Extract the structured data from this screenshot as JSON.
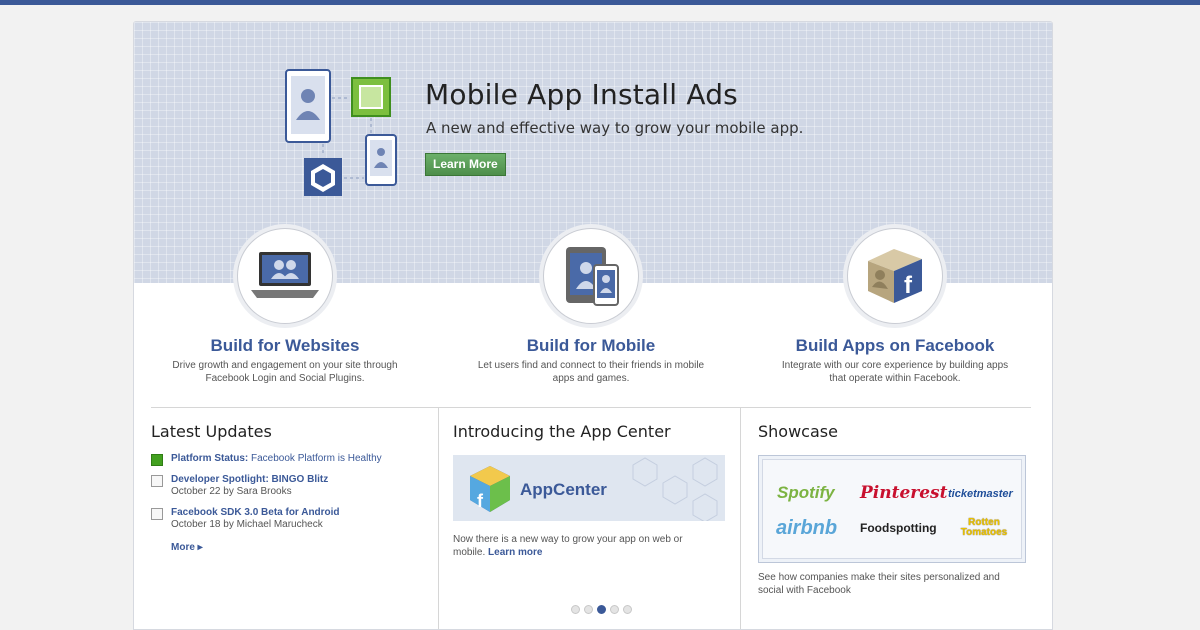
{
  "hero": {
    "title": "Mobile App Install Ads",
    "subtitle": "A new and effective way to grow your mobile app.",
    "cta_label": "Learn More"
  },
  "features": [
    {
      "title": "Build for Websites",
      "desc": "Drive growth and engagement on your site through Facebook Login and Social Plugins."
    },
    {
      "title": "Build for Mobile",
      "desc": "Let users find and connect to their friends in mobile apps and games."
    },
    {
      "title": "Build Apps on Facebook",
      "desc": "Integrate with our core experience by building apps that operate within Facebook."
    }
  ],
  "latest": {
    "title": "Latest Updates",
    "items": [
      {
        "label": "Platform Status:",
        "value": "Facebook Platform is Healthy",
        "meta": ""
      },
      {
        "label": "Developer Spotlight: BINGO Blitz",
        "value": "",
        "meta_date": "October 22 by ",
        "meta_author": "Sara Brooks"
      },
      {
        "label": "Facebook SDK 3.0 Beta for Android",
        "value": "",
        "meta_date": "October 18 by ",
        "meta_author": "Michael Marucheck"
      }
    ],
    "more_label": "More ▸"
  },
  "intro": {
    "title": "Introducing the App Center",
    "banner_text": "AppCenter",
    "desc": "Now there is a new way to grow your app on web or mobile.",
    "link": "Learn more",
    "carousel_active_index": 2,
    "carousel_count": 5
  },
  "showcase": {
    "title": "Showcase",
    "logos": [
      "Spotify",
      "Pinterest",
      "ticketmaster",
      "airbnb",
      "Foodspotting",
      "Rotten Tomatoes"
    ],
    "desc": "See how companies make their sites personalized and social with Facebook"
  },
  "colors": {
    "brand": "#3b5998",
    "hero_bg": "#d0d7e5",
    "cta_green": "#5a9e57",
    "status_green": "#42a01f"
  }
}
